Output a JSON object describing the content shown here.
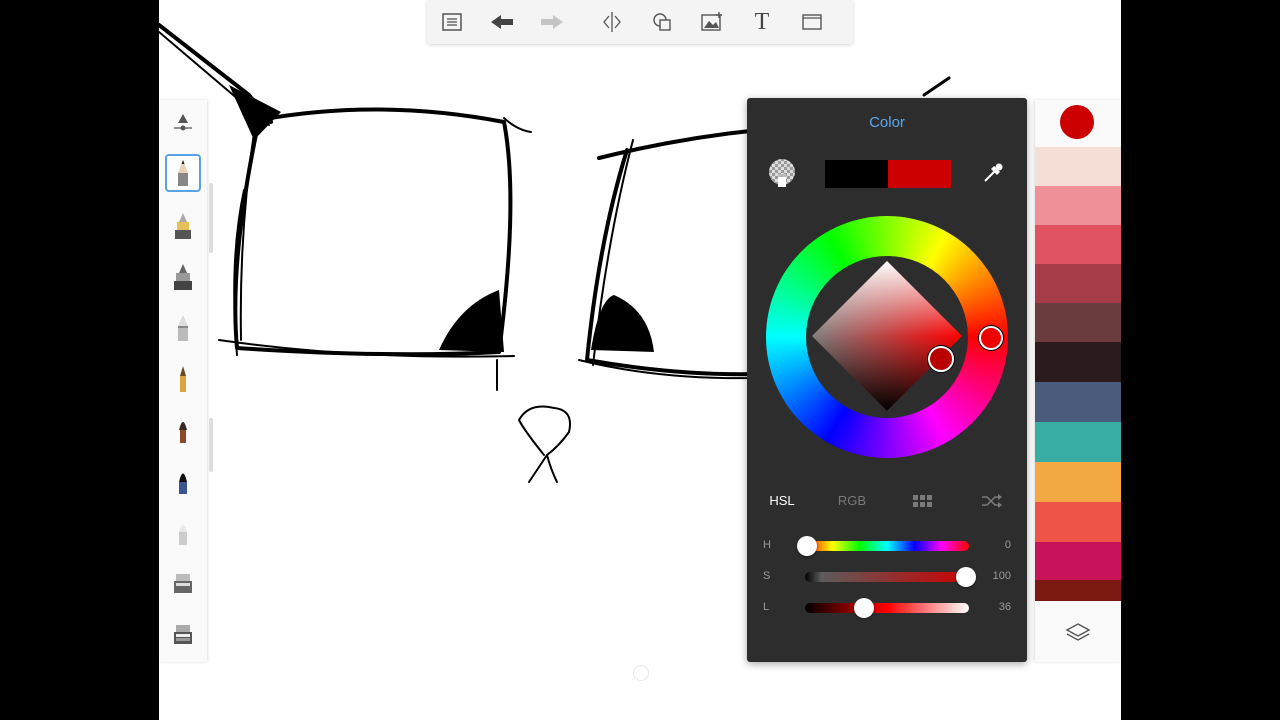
{
  "toolbar": {
    "icons": [
      "list-icon",
      "undo-icon",
      "redo-icon",
      "symmetry-icon",
      "shapes-icon",
      "image-icon",
      "text-icon",
      "fullscreen-icon"
    ],
    "text_tool_label": "T"
  },
  "brushes": [
    "brush-size-icon",
    "pencil-icon",
    "marker-icon",
    "felt-pen-icon",
    "airbrush-icon",
    "ballpoint-pen-icon",
    "paint-brush-icon",
    "ink-brush-icon",
    "soft-eraser-icon",
    "fill-tool-icon",
    "gradient-fill-icon"
  ],
  "palette": {
    "current_color": "#cc0000",
    "swatches": [
      "#f4ded6",
      "#ef8f97",
      "#e05462",
      "#a53c47",
      "#6b3b3e",
      "#2b1b1c",
      "#4a5b7c",
      "#37ada3",
      "#f4a844",
      "#ee5548",
      "#c8125a",
      "#7a1a12"
    ]
  },
  "color_panel": {
    "title": "Color",
    "previous_color": "#000000",
    "current_color": "#cc0000",
    "tabs": {
      "hsl": "HSL",
      "rgb": "RGB"
    },
    "active_tab": "HSL",
    "sliders": {
      "h": {
        "label": "H",
        "value": "0"
      },
      "s": {
        "label": "S",
        "value": "100"
      },
      "l": {
        "label": "L",
        "value": "36"
      }
    }
  }
}
